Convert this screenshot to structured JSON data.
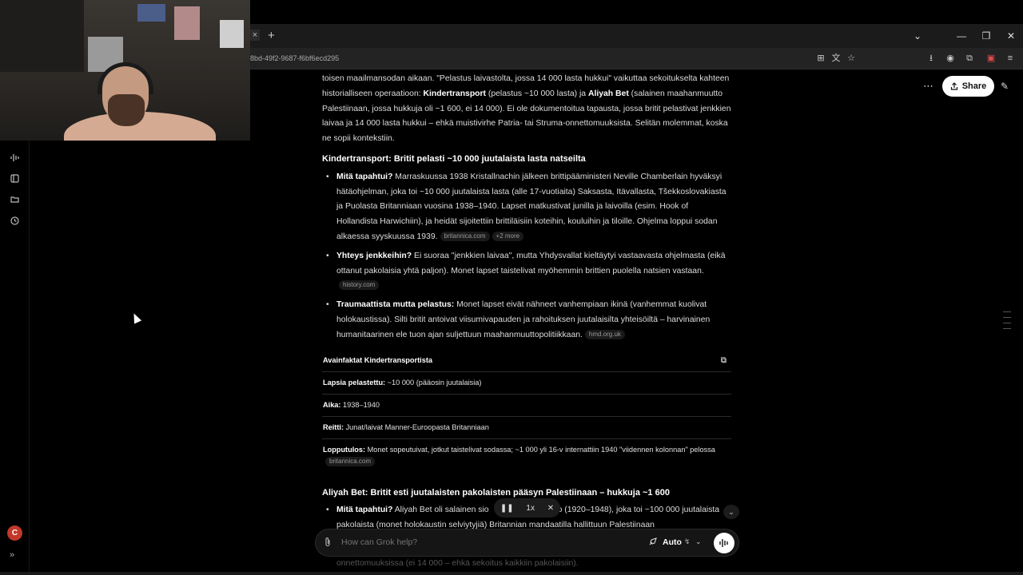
{
  "browser": {
    "tab_close": "×",
    "new_tab": "+",
    "url": "8bd-49f2-9687-f6bf6ecd295",
    "window_controls": [
      "⌄",
      "—",
      "❐",
      "✕"
    ],
    "address_icons": [
      "⊞",
      "文",
      "☆",
      "⭳",
      "◉",
      "⧉",
      "▣",
      "≡"
    ]
  },
  "rail": {
    "icons": [
      "voice-icon",
      "book-icon",
      "folder-icon",
      "history-icon"
    ],
    "avatar_initial": "C",
    "expand": "»"
  },
  "header": {
    "more": "⋯",
    "share_label": "Share",
    "edit": "✎"
  },
  "content": {
    "intro": {
      "t1": "toisen maailmansodan aikaan. \"Pelastus laivastolta, jossa 14 000 lasta hukkui\" vaikuttaa sekoitukselta kahteen historialliseen operaatioon: ",
      "b1": "Kindertransport",
      "t2": " (pelastus ~10 000 lasta) ja ",
      "b2": "Aliyah Bet",
      "t3": " (salainen maahanmuutto Palestiinaan, jossa hukkuja oli ~1 600, ei 14 000). Ei ole dokumentoitua tapausta, jossa britit pelastivat jenkkien laivaa ja 14 000 lasta hukkui – ehkä muistivirhe Patria- tai Struma-onnettomuuksista. Selitän molemmat, koska ne sopii kontekstiin."
    },
    "section1_title": "Kindertransport: Britit pelasti ~10 000 juutalaista lasta natseilta",
    "bullets": [
      {
        "label": "Mitä tapahtui?",
        "text": " Marraskuussa 1938 Kristallnachin jälkeen brittipääministeri Neville Chamberlain hyväksyi hätäohjelman, joka toi ~10 000 juutalaista lasta (alle 17-vuotiaita) Saksasta, Itävallasta, Tšekkoslovakiasta ja Puolasta Britanniaan vuosina 1938–1940. Lapset matkustivat junilla ja laivoilla (esim. Hook of Hollandista Harwichiin), ja heidät sijoitettiin brittiläisiin koteihin, kouluihin ja tiloille. Ohjelma loppui sodan alkaessa syyskuussa 1939.",
        "src1": "britannica.com",
        "src2": "+2 more"
      },
      {
        "label": "Yhteys jenkkeihin?",
        "text": " Ei suoraa \"jenkkien laivaa\", mutta Yhdysvallat kieltäytyi vastaavasta ohjelmasta (eikä ottanut pakolaisia yhtä paljon). Monet lapset taistelivat myöhemmin brittien puolella natsien vastaan.",
        "src1": "history.com"
      },
      {
        "label": "Traumaattista mutta pelastus:",
        "text": " Monet lapset eivät nähneet vanhempiaan ikinä (vanhemmat kuolivat holokaustissa). Silti britit antoivat viisumivapauden ja rahoituksen juutalaisilta yhteisöiltä – harvinainen humanitaarinen ele tuon ajan suljettuun maahanmuuttopolitiikkaan.",
        "src1": "hmd.org.uk"
      }
    ],
    "table": {
      "title": "Avainfaktat Kindertransportista",
      "copy": "⧉",
      "rows": [
        {
          "label": "Lapsia pelastettu:",
          "value": " ~10 000 (pääosin juutalaisia)"
        },
        {
          "label": "Aika:",
          "value": " 1938–1940"
        },
        {
          "label": "Reitti:",
          "value": " Junat/laivat Manner-Euroopasta Britanniaan"
        },
        {
          "label": "Lopputulos:",
          "value": " Monet sopeutuivat, jotkut taistelivat sodassa; ~1 000 yli 16-v internattiin 1940 \"viidennen kolonnan\" pelossa",
          "src": "britannica.com"
        }
      ]
    },
    "section2_title": "Aliyah Bet: Britit esti juutalaisten pakolaisten pääsyn Palestiinaan – hukkuja ~1 600",
    "bullet2": {
      "label": "Mitä tapahtui?",
      "text": " Aliyah Bet oli salainen sio",
      "text_tail": "o (1920–1948), joka toi ~100 000 juutalaista pakolaista (monet holokaustin selviytyjiä) Britannian mandaatilla hallittuun Palestiinaan"
    },
    "fade_text": "onnettomuuksissa (ei 14 000 – ehkä sekoitus kaikkiin pakolaisiin)."
  },
  "audio": {
    "pause": "❚❚",
    "speed": "1x",
    "close": "✕"
  },
  "scroll_down": "⌄",
  "composer": {
    "placeholder": "How can Grok help?",
    "mode": "Auto",
    "mode_extra": "↯",
    "chevron": "⌄",
    "voice": "|||"
  }
}
